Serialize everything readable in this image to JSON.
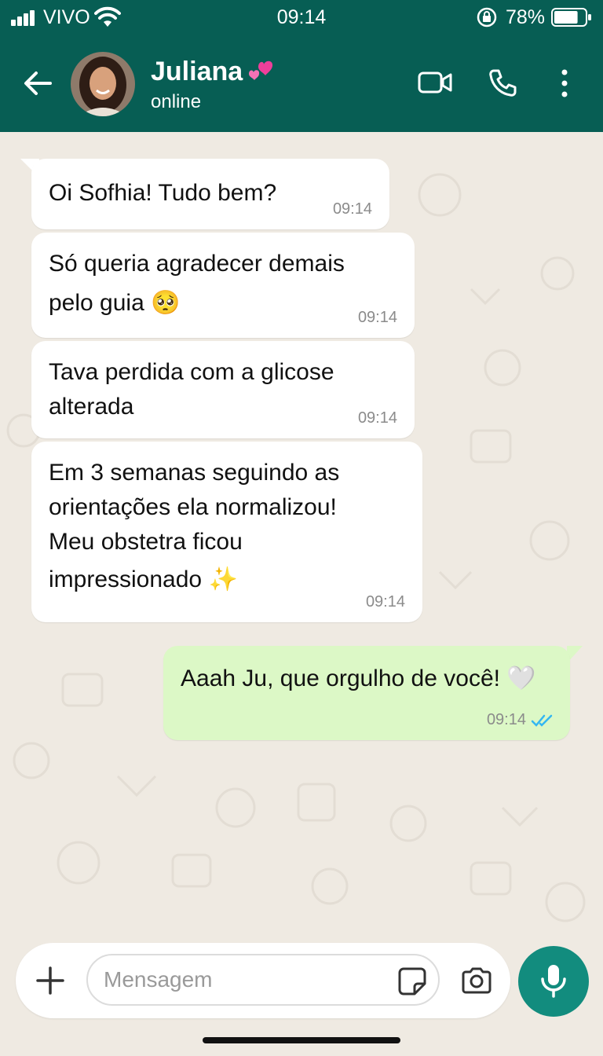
{
  "status_bar": {
    "carrier": "VIVO",
    "time": "09:14",
    "battery": "78%",
    "battery_level": 0.78
  },
  "header": {
    "contact_name": "Juliana",
    "presence": "online",
    "icons": [
      "back-arrow-icon",
      "video-call-icon",
      "voice-call-icon",
      "more-options-icon"
    ],
    "accent_color": "#075e54"
  },
  "messages": [
    {
      "direction": "incoming",
      "lines": [
        "Oi Sofhia! Tudo bem?"
      ],
      "time": "09:14"
    },
    {
      "direction": "incoming",
      "lines": [
        "Só queria agradecer demais",
        "pelo guia 🥺"
      ],
      "time": "09:14"
    },
    {
      "direction": "incoming",
      "lines": [
        "Tava perdida com a glicose",
        "alterada"
      ],
      "time": "09:14"
    },
    {
      "direction": "incoming",
      "lines": [
        "Em 3 semanas seguindo as",
        "orientações ela normalizou!",
        "Meu obstetra ficou",
        "impressionado ✨"
      ],
      "time": "09:14"
    },
    {
      "direction": "outgoing",
      "lines": [
        "Aaah Ju, que orgulho de você! 🤍"
      ],
      "time": "09:14",
      "status": "read"
    }
  ],
  "composer": {
    "placeholder": "Mensagem",
    "icons": [
      "plus-icon",
      "sticker-icon",
      "camera-icon",
      "microphone-icon"
    ]
  },
  "colors": {
    "chat_bg": "#efeae2",
    "outgoing_bubble": "#dcf8c6",
    "incoming_bubble": "#ffffff",
    "read_ticks": "#34b7f1"
  }
}
